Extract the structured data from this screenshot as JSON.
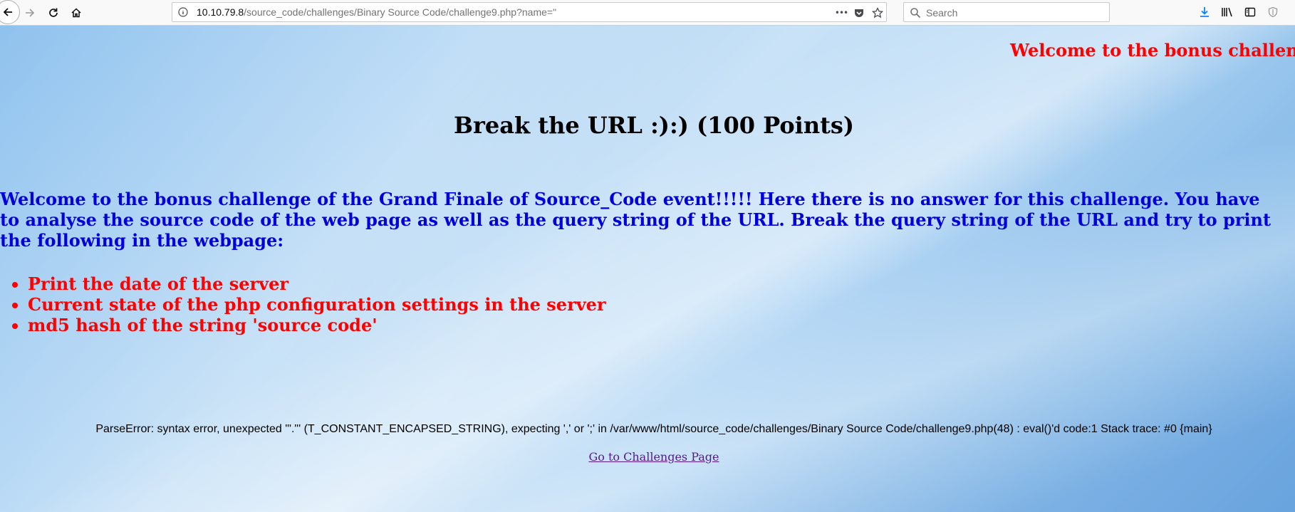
{
  "browser": {
    "url_host": "10.10.79.8",
    "url_path": "/source_code/challenges/Binary Source Code/challenge9.php?name=\"",
    "search_placeholder": "Search",
    "url_actions_icon": "•••"
  },
  "page": {
    "marquee_text": "Welcome to the bonus challen",
    "title": "Break the URL :):) (100 Points)",
    "intro": "Welcome to the bonus challenge of the Grand Finale of Source_Code event!!!!! Here there is no answer for this challenge. You have to analyse the source code of the web page as well as the query string of the URL. Break the query string of the URL and try to print the following in the webpage:",
    "tasks": [
      "Print the date of the server",
      "Current state of the php configuration settings in the server",
      "md5 hash of the string 'source code'"
    ],
    "error": "ParseError: syntax error, unexpected '\".\"' (T_CONSTANT_ENCAPSED_STRING), expecting ',' or ';' in /var/www/html/source_code/challenges/Binary Source Code/challenge9.php(48) : eval()'d code:1 Stack trace: #0 {main}",
    "link": "Go to Challenges Page"
  },
  "colors": {
    "marquee": "#ff0000",
    "intro": "#0000dd",
    "tasks": "#ff0000",
    "link": "#551a8b"
  }
}
